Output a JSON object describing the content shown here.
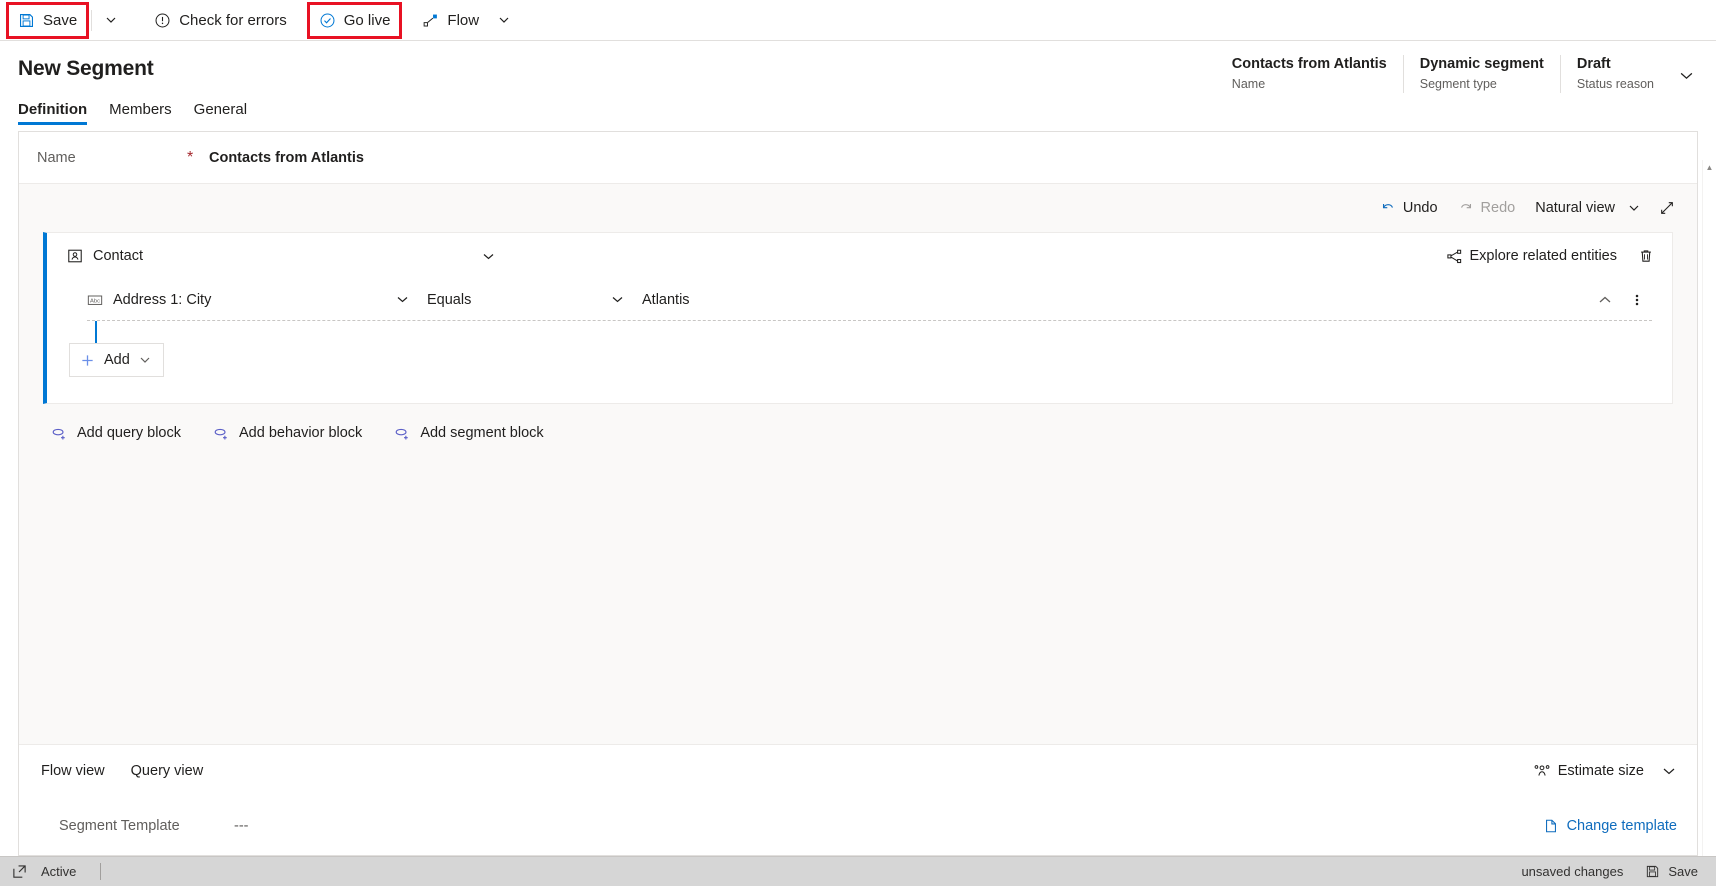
{
  "commandbar": {
    "save_label": "Save",
    "save_caret_icon": "chevron-down-icon",
    "check_errors_label": "Check for errors",
    "check_errors_icon": "error-circle-icon",
    "go_live_label": "Go live",
    "go_live_icon": "check-circle-icon",
    "flow_label": "Flow",
    "flow_icon": "flow-icon",
    "flow_caret_icon": "chevron-down-icon",
    "save_icon": "save-floppy-icon",
    "highlight_color": "#e81123"
  },
  "header": {
    "title": "New Segment",
    "meta": [
      {
        "value": "Contacts from Atlantis",
        "label": "Name"
      },
      {
        "value": "Dynamic segment",
        "label": "Segment type"
      },
      {
        "value": "Draft",
        "label": "Status reason"
      }
    ],
    "expand_icon": "chevron-down-icon"
  },
  "tabs": [
    {
      "label": "Definition",
      "active": true
    },
    {
      "label": "Members",
      "active": false
    },
    {
      "label": "General",
      "active": false
    }
  ],
  "form": {
    "name_label": "Name",
    "required_marker": "*",
    "name_value": "Contacts from Atlantis"
  },
  "canvas_toolbar": {
    "undo_label": "Undo",
    "undo_icon": "undo-arrow-icon",
    "redo_label": "Redo",
    "redo_icon": "redo-arrow-icon",
    "view_label": "Natural view",
    "view_caret_icon": "chevron-down-icon",
    "expand_icon": "expand-diagonal-icon"
  },
  "query_block": {
    "entity_icon": "contact-card-icon",
    "entity_name": "Contact",
    "collapse_icon": "chevron-down-icon",
    "explore_label": "Explore related entities",
    "explore_icon": "share-nodes-icon",
    "delete_icon": "trash-icon",
    "condition": {
      "attribute_icon": "abc-text-icon",
      "attribute": "Address 1: City",
      "attribute_caret_icon": "chevron-down-icon",
      "operator": "Equals",
      "operator_caret_icon": "chevron-down-icon",
      "value": "Atlantis",
      "collapse_icon": "chevron-up-icon",
      "more_icon": "more-vertical-icon"
    },
    "add_label": "Add",
    "add_icon": "plus-icon",
    "add_caret_icon": "chevron-down-icon",
    "accent_color": "#0078d4"
  },
  "block_links": [
    {
      "label": "Add query block",
      "icon": "add-branch-icon"
    },
    {
      "label": "Add behavior block",
      "icon": "add-branch-icon"
    },
    {
      "label": "Add segment block",
      "icon": "add-branch-icon"
    }
  ],
  "bottom_panel": {
    "flow_view_label": "Flow view",
    "query_view_label": "Query view",
    "estimate_label": "Estimate size",
    "estimate_icon": "people-group-icon",
    "estimate_caret_icon": "chevron-down-icon",
    "template_label": "Segment Template",
    "template_value": "---",
    "change_template_label": "Change template",
    "change_template_icon": "page-edit-icon"
  },
  "statusbar": {
    "expand_icon": "popout-icon",
    "state_label": "Active",
    "unsaved_label": "unsaved changes",
    "save_label": "Save",
    "save_icon": "save-floppy-icon"
  }
}
